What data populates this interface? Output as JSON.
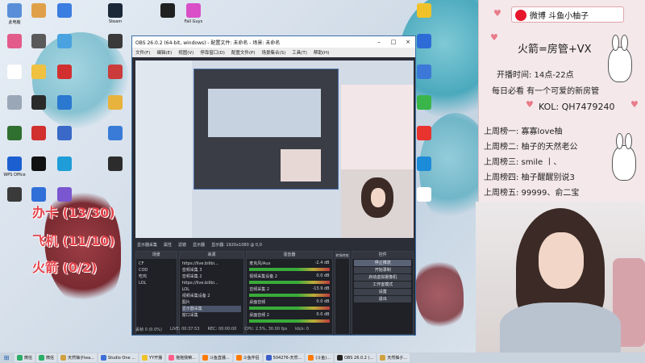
{
  "desktop": {
    "col1": [
      {
        "label": "此电脑",
        "color": "#5a8fd8"
      },
      {
        "label": "",
        "color": "#e25b8a"
      },
      {
        "label": "",
        "color": "#ffffff"
      },
      {
        "label": "",
        "color": "#9aa7b6"
      },
      {
        "label": "",
        "color": "#2f6f2f"
      },
      {
        "label": "WPS Office",
        "color": "#1c5fd1"
      },
      {
        "label": "",
        "color": "#3a3a3a"
      }
    ],
    "col2": [
      {
        "label": "",
        "color": "#e0a04a"
      },
      {
        "label": "",
        "color": "#5a5a5a"
      },
      {
        "label": "",
        "color": "#f0c040"
      },
      {
        "label": "",
        "color": "#2a2a2a"
      },
      {
        "label": "",
        "color": "#d22f2f"
      },
      {
        "label": "",
        "color": "#111111"
      },
      {
        "label": "",
        "color": "#2f6fd8"
      }
    ],
    "col3": [
      {
        "label": "",
        "color": "#3b7de0"
      },
      {
        "label": "",
        "color": "#4aa3e0"
      },
      {
        "label": "",
        "color": "#d23030"
      },
      {
        "label": "",
        "color": "#2a78d0"
      },
      {
        "label": "",
        "color": "#3a69c8"
      },
      {
        "label": "",
        "color": "#1f9dd8"
      },
      {
        "label": "",
        "color": "#7a56d0"
      }
    ],
    "col4": [
      {
        "label": "Steam",
        "color": "#1b2838"
      },
      {
        "label": "",
        "color": "#3a3a3a"
      },
      {
        "label": "",
        "color": "#cc3b3b"
      },
      {
        "label": "",
        "color": "#e7b33c"
      },
      {
        "label": "",
        "color": "#3a7bd8"
      },
      {
        "label": "",
        "color": "#2c2c2c"
      }
    ],
    "col5": [
      {
        "label": "",
        "color": "#202020"
      }
    ],
    "col6": [
      {
        "label": "Fall Guys",
        "color": "#d84fc7"
      }
    ],
    "col7": [
      {
        "label": "",
        "color": "#f0c22a"
      },
      {
        "label": "",
        "color": "#2d6cd6"
      },
      {
        "label": "",
        "color": "#3c78d8"
      },
      {
        "label": "",
        "color": "#39b54a"
      },
      {
        "label": "",
        "color": "#e8332e"
      },
      {
        "label": "",
        "color": "#1d8cd8"
      },
      {
        "label": "",
        "color": "#ffffff"
      }
    ]
  },
  "overlay": {
    "line1": "办卡 (13/30)",
    "line2": "飞机 (11/10)",
    "line3": "火箭 (0/2)"
  },
  "obs": {
    "title": "OBS 26.0.2 (64-bit, windows) - 配置文件: 未命名 - 场景: 未命名",
    "menu": [
      "文件(F)",
      "编辑(E)",
      "视图(V)",
      "停靠窗口(D)",
      "配置文件(P)",
      "场景集合(S)",
      "工具(T)",
      "帮助(H)"
    ],
    "status_left": "显示器采集",
    "status_items": [
      "属性",
      "滤镜",
      "显示器",
      "显示器: 1920x1080 @ 0,0"
    ],
    "docks": {
      "scenes": {
        "title": "场景",
        "items": [
          "CF",
          "COD",
          "吃鸡",
          "LOL"
        ]
      },
      "sources": {
        "title": "来源",
        "items": [
          "https://live.bilibi...",
          "音频采集 3",
          "音频采集 2",
          "https://live.bilibi...",
          "LOL",
          "视频采集设备 2",
          "图片",
          "显示器采集",
          "窗口采集"
        ]
      },
      "mixer": {
        "title": "混音器",
        "channels": [
          "麦克风/Aux",
          "视频采集设备 2",
          "音频采集 2",
          "桌面音频",
          "桌面音频 2"
        ],
        "levels": [
          "-2.4 dB",
          "0.0 dB",
          "-13.9 dB",
          "0.0 dB",
          "0.0 dB"
        ]
      },
      "transitions": {
        "title": "转场特效"
      },
      "controls": {
        "title": "控件",
        "buttons": [
          "停止推流",
          "开始录制",
          "启动虚拟摄像机",
          "工作室模式",
          "设置",
          "退出"
        ]
      }
    },
    "footer": {
      "drop": "丢帧 0 (0.0%)",
      "live": "LIVE: 00:37:53",
      "rec": "REC: 00:00:00",
      "cpu": "CPU: 2.5%, 30.00 fps",
      "kbps": "kb/s: 0"
    }
  },
  "panel": {
    "weibo": "微博 斗鱼小柚子",
    "rocket": "火箭=房管+VX",
    "schedule": "开播时间: 14点-22点",
    "daily": "每日必看 有一个可爱的新房管",
    "kol": "KOL: QH7479240",
    "boards": [
      "上周榜一: 寡寡love柚",
      "上周榜二: 柚子的天然老公",
      "上周榜三: smile 丨、",
      "上周榜四: 柚子醒醒别说3",
      "上周榜五: 99999、俞二宝"
    ]
  },
  "taskbar": {
    "items": [
      {
        "label": "微信",
        "color": "#2aae67"
      },
      {
        "label": "微信",
        "color": "#2aae67"
      },
      {
        "label": "天然柚子tea...",
        "color": "#d0a040"
      },
      {
        "label": "Studio One ...",
        "color": "#3c6ed8"
      },
      {
        "label": "YY开播",
        "color": "#f0c22a"
      },
      {
        "label": "拖拖我嘛...",
        "color": "#ff5c8a"
      },
      {
        "label": "斗鱼直播...",
        "color": "#ff7a00"
      },
      {
        "label": "斗鱼伴侣",
        "color": "#ff7a00"
      },
      {
        "label": "504276-天然...",
        "color": "#3a5dc8"
      },
      {
        "label": "(斗鱼)...",
        "color": "#ff7a00"
      },
      {
        "label": "OBS 26.0.2 (...",
        "color": "#222222"
      },
      {
        "label": "天然柚子...",
        "color": "#d0a040"
      }
    ]
  }
}
